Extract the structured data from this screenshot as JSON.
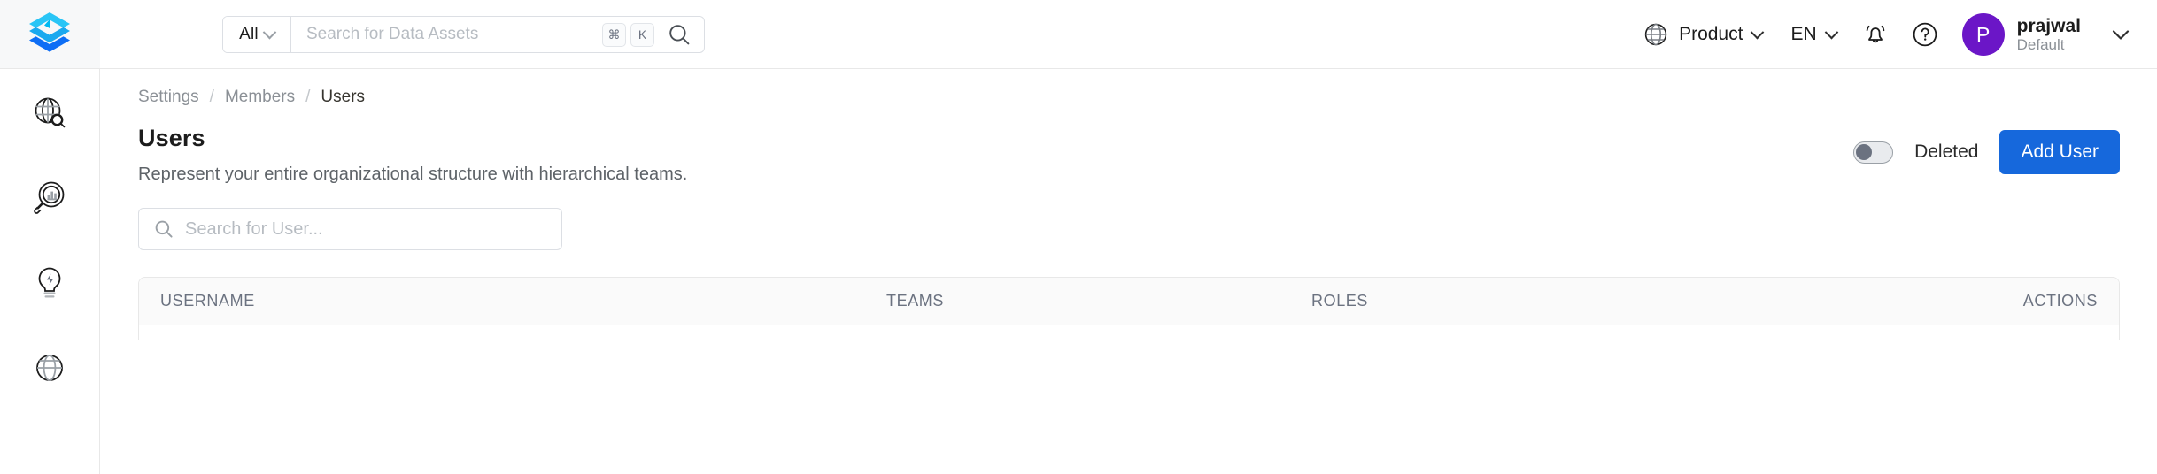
{
  "brand": {
    "logo_icon": "openmetadata-logo",
    "colors": {
      "cyan": "#29c5f6",
      "blue": "#1668dc",
      "accent": "#1668dc",
      "avatar": "#6b16c7"
    }
  },
  "sidebar": {
    "items": [
      {
        "icon": "globe-search-icon",
        "name": "explore"
      },
      {
        "icon": "magnifier-chart-icon",
        "name": "observability"
      },
      {
        "icon": "lightbulb-bolt-icon",
        "name": "insights"
      },
      {
        "icon": "globe-icon",
        "name": "govern"
      }
    ]
  },
  "header": {
    "search": {
      "scope_label": "All",
      "placeholder": "Search for Data Assets",
      "shortcut_keys": [
        "⌘",
        "K"
      ],
      "search_icon": "search-icon"
    },
    "product_menu": {
      "label": "Product",
      "icon": "globe-icon"
    },
    "language_menu": {
      "label": "EN"
    },
    "notifications_icon": "bell-icon",
    "help_icon": "help-circle-icon",
    "user": {
      "initial": "P",
      "name": "prajwal",
      "subtitle": "Default"
    }
  },
  "breadcrumb": {
    "items": [
      {
        "label": "Settings",
        "active": false
      },
      {
        "label": "Members",
        "active": false
      },
      {
        "label": "Users",
        "active": true
      }
    ],
    "separator": "/"
  },
  "page": {
    "title": "Users",
    "description": "Represent your entire organizational structure with hierarchical teams.",
    "deleted_toggle": {
      "label": "Deleted",
      "enabled": false
    },
    "add_button_label": "Add User",
    "user_search": {
      "placeholder": "Search for User...",
      "icon": "search-icon",
      "value": ""
    }
  },
  "table": {
    "columns": [
      {
        "label": "USERNAME",
        "key": "username"
      },
      {
        "label": "TEAMS",
        "key": "teams"
      },
      {
        "label": "ROLES",
        "key": "roles"
      },
      {
        "label": "ACTIONS",
        "key": "actions"
      }
    ],
    "rows": []
  }
}
